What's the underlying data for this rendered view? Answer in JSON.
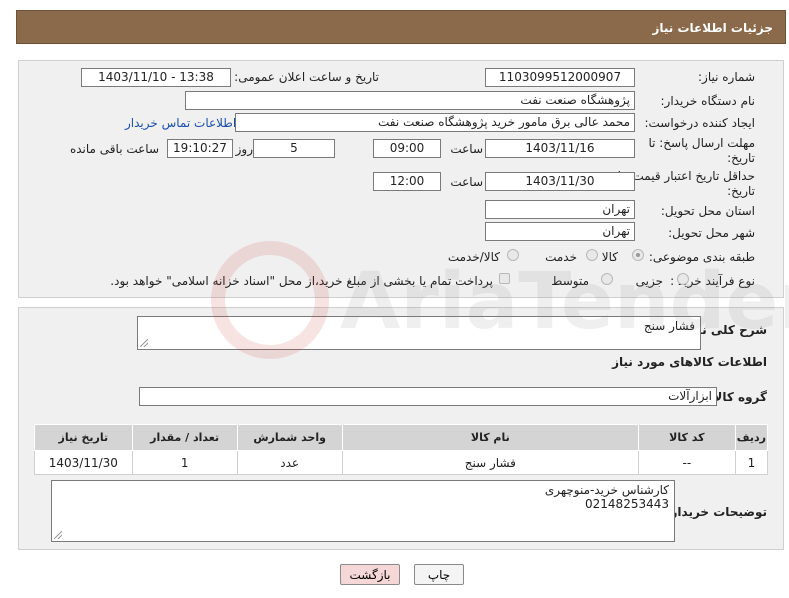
{
  "header": {
    "title": "جزئیات اطلاعات نیاز"
  },
  "form": {
    "need_number_label": "شماره نیاز:",
    "need_number": "1103099512000907",
    "announce_label": "تاریخ و ساعت اعلان عمومی:",
    "announce_value": "1403/11/10 - 13:38",
    "buyer_org_label": "نام دستگاه خریدار:",
    "buyer_org": "پژوهشگاه صنعت نفت",
    "creator_label": "ایجاد کننده درخواست:",
    "creator": "محمد عالی برق مامور خرید پژوهشگاه صنعت نفت",
    "contact_link": "اطلاعات تماس خریدار",
    "reply_deadline_label_1": "مهلت ارسال پاسخ: تا",
    "reply_deadline_label_2": "تاریخ:",
    "reply_date": "1403/11/16",
    "time_label": "ساعت",
    "reply_time": "09:00",
    "days_value": "5",
    "days_label": "روز و",
    "remaining_time": "19:10:27",
    "remaining_label": "ساعت باقی مانده",
    "price_validity_label_1": "حداقل تاریخ اعتبار قیمت: تا",
    "price_validity_label_2": "تاریخ:",
    "price_date": "1403/11/30",
    "price_time_label": "ساعت",
    "price_time": "12:00",
    "province_label": "استان محل تحویل:",
    "province": "تهران",
    "city_label": "شهر محل تحویل:",
    "city": "تهران",
    "category_label": "طبقه بندی موضوعی:",
    "category_options": [
      "کالا",
      "خدمت",
      "کالا/خدمت"
    ],
    "category_selected": "کالا",
    "process_label": "نوع فرآیند خرید :",
    "process_options": [
      "جزیی",
      "متوسط"
    ],
    "payment_note": "پرداخت تمام یا بخشی از مبلغ خرید،از محل \"اسناد خزانه اسلامی\" خواهد بود."
  },
  "details": {
    "summary_label": "شرح کلی نیاز:",
    "summary": "فشار سنج",
    "items_heading": "اطلاعات کالاهای مورد نیاز",
    "group_label": "گروه کالا:",
    "group": "ابزارآلات",
    "table_headers": [
      "ردیف",
      "کد کالا",
      "نام کالا",
      "واحد شمارش",
      "تعداد / مقدار",
      "تاریخ نیاز"
    ],
    "rows": [
      [
        "1",
        "--",
        "فشار سنج",
        "عدد",
        "1",
        "1403/11/30"
      ]
    ],
    "buyer_notes_label": "توضیحات خریدار:",
    "buyer_notes_line1": "کارشناس خرید-منوچهری",
    "buyer_notes_line2": "02148253443"
  },
  "buttons": {
    "print": "چاپ",
    "back": "بازگشت"
  },
  "watermark": {
    "text": "AriaTender.neT"
  },
  "colors": {
    "header_bg": "#8a6a4a",
    "link": "#1a4fb0",
    "back_button_bg": "#f6d7d7",
    "panel_bg": "#f0f0f0"
  }
}
